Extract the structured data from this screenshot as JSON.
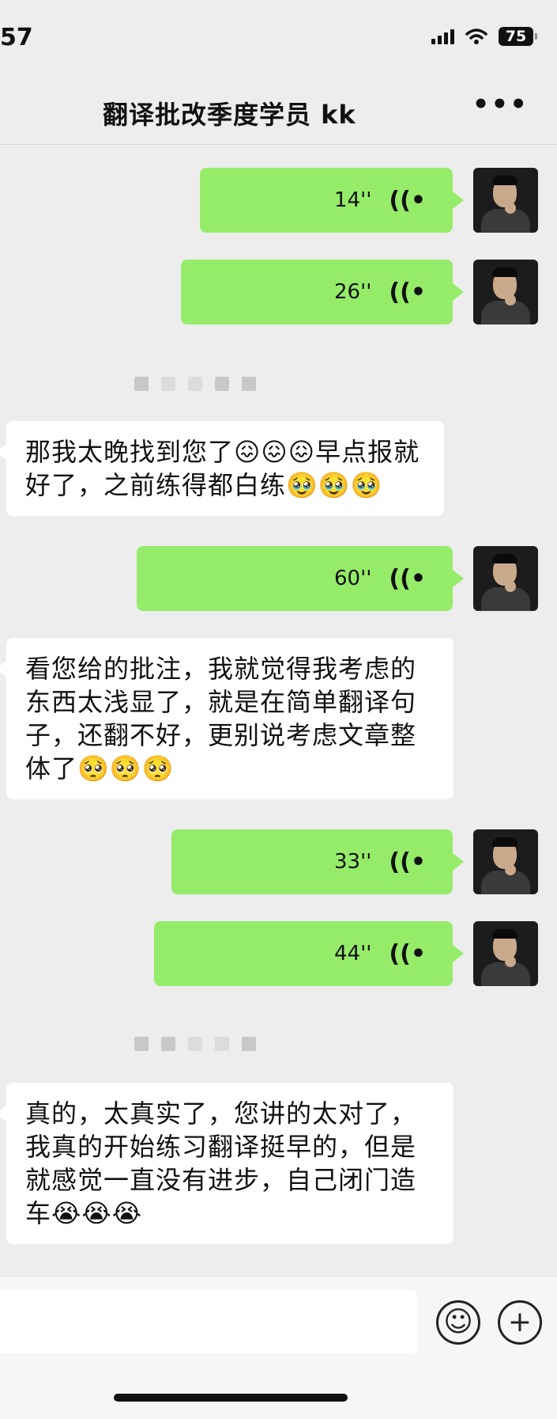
{
  "status": {
    "time": "57",
    "battery": "75"
  },
  "header": {
    "title": "翻译批改季度学员 kk",
    "more": "•••"
  },
  "voices": [
    "14''",
    "26''",
    "60''",
    "33''",
    "44''"
  ],
  "voice_icon": "((•",
  "messages": [
    "那我太晚找到您了😖😖😖早点报就好了，之前练得都白练🥹🥹🥹",
    "看您给的批注，我就觉得我考虑的东西太浅显了，就是在简单翻译句子，还翻不好，更别说考虑文章整体了🥺🥺🥺",
    "真的，太真实了，您讲的太对了，我真的开始练习翻译挺早的，但是就感觉一直没有进步，自己闭门造车😭😭😭"
  ],
  "input": {
    "emoji": "☺",
    "plus": "+"
  },
  "colors": {
    "sent_bubble": "#95ec69",
    "received_bubble": "#ffffff",
    "background": "#ededed"
  }
}
